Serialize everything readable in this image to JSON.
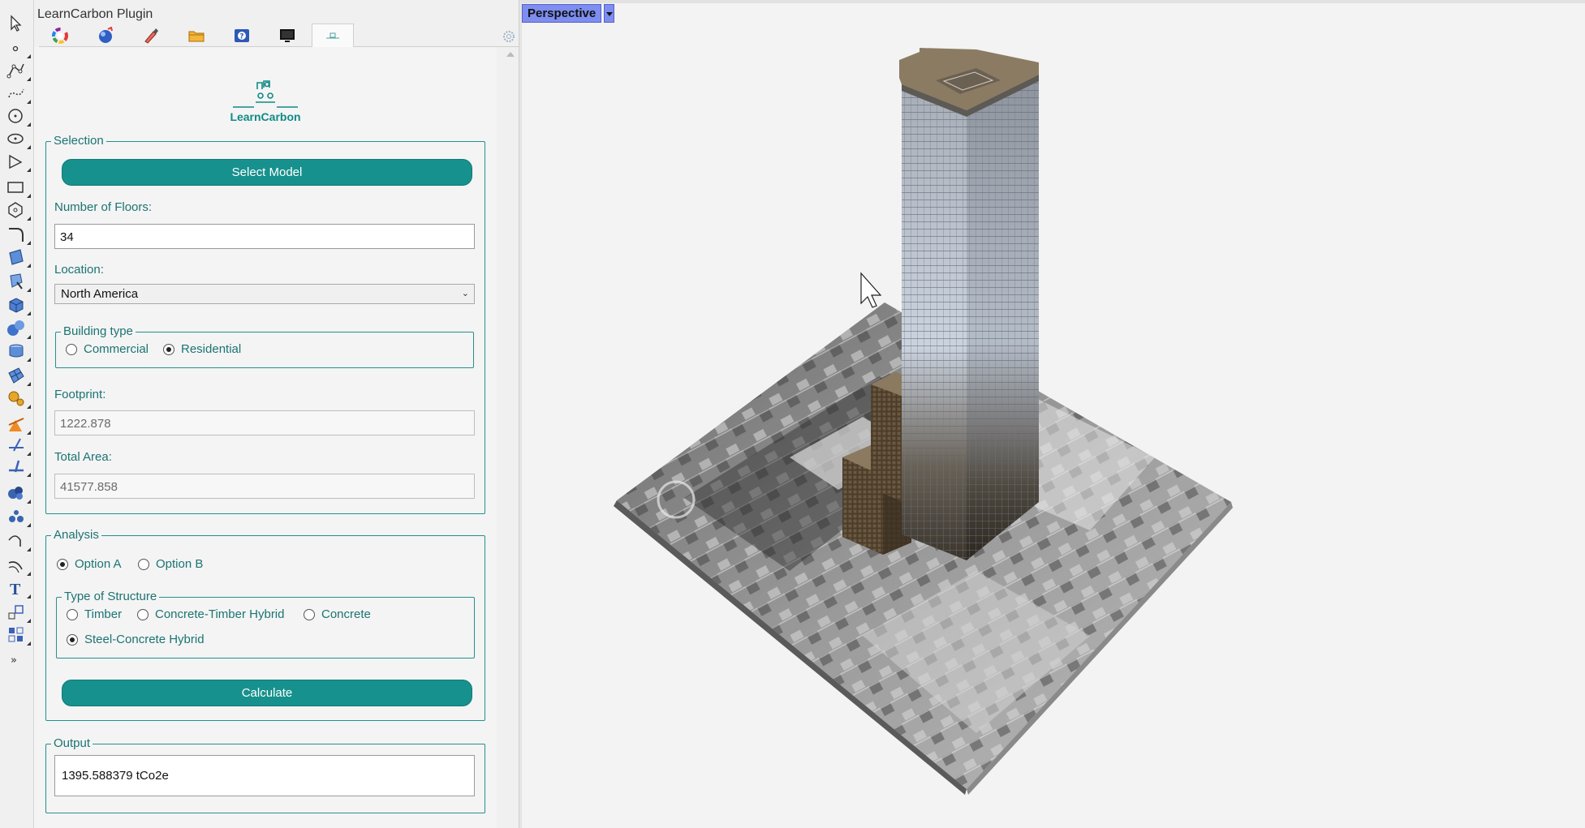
{
  "panel": {
    "title": "LearnCarbon Plugin",
    "tabs": [
      {
        "icon": "color-wheel-icon"
      },
      {
        "icon": "material-sphere-icon"
      },
      {
        "icon": "paint-brush-icon"
      },
      {
        "icon": "folder-icon"
      },
      {
        "icon": "help-icon"
      },
      {
        "icon": "display-icon"
      },
      {
        "icon": "learncarbon-icon",
        "active": true
      }
    ]
  },
  "logo": {
    "text": "LearnCarbon"
  },
  "selection": {
    "legend": "Selection",
    "select_button": "Select Model",
    "floors_label": "Number of Floors:",
    "floors_value": "34",
    "location_label": "Location:",
    "location_value": "North America",
    "building_type": {
      "legend": "Building type",
      "options": [
        {
          "label": "Commercial",
          "checked": false
        },
        {
          "label": "Residential",
          "checked": true
        }
      ]
    },
    "footprint_label": "Footprint:",
    "footprint_value": "1222.878",
    "total_area_label": "Total Area:",
    "total_area_value": "41577.858"
  },
  "analysis": {
    "legend": "Analysis",
    "options": [
      {
        "label": "Option A",
        "checked": true
      },
      {
        "label": "Option B",
        "checked": false
      }
    ],
    "structure": {
      "legend": "Type of Structure",
      "options": [
        {
          "label": "Timber",
          "checked": false
        },
        {
          "label": "Concrete-Timber Hybrid",
          "checked": false
        },
        {
          "label": "Concrete",
          "checked": false
        },
        {
          "label": "Steel-Concrete Hybrid",
          "checked": true
        }
      ]
    },
    "calculate_button": "Calculate"
  },
  "output": {
    "legend": "Output",
    "value": "1395.588379 tCo2e"
  },
  "viewport": {
    "title": "Perspective"
  },
  "colors": {
    "accent": "#17918d",
    "viewport_tab": "#7d8df0"
  }
}
